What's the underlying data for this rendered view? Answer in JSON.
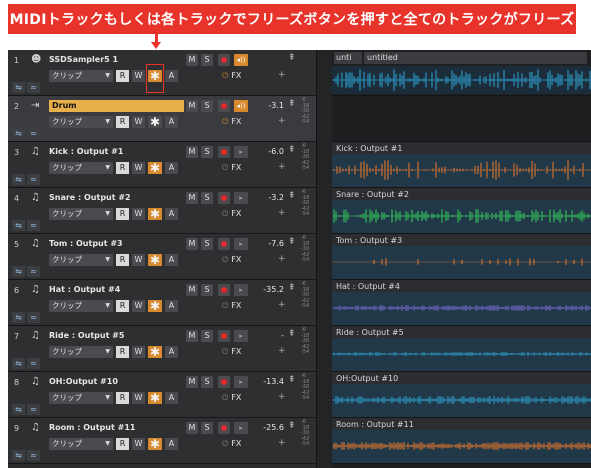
{
  "banner": {
    "text": "MIDIトラックもしくは各トラックでフリーズボタンを押すと全てのトラックがフリーズ"
  },
  "colors": {
    "accent": "#e8332a",
    "freeze_on": "#d98a2e",
    "wave_blue": "#2fa7d8",
    "wave_orange": "#f07a2a",
    "wave_green": "#38d45c",
    "wave_purple": "#7a6fd8"
  },
  "common": {
    "clip_label": "クリップ",
    "r_label": "R",
    "w_label": "W",
    "a_label": "A",
    "m_label": "M",
    "s_label": "S",
    "fx_label": "FX",
    "freeze_icon": "✱"
  },
  "tracks": [
    {
      "num": "1",
      "name": "SSDSampler5 1",
      "vol": "",
      "type": "midi"
    },
    {
      "num": "2",
      "name": "Drum",
      "vol": "-3.1",
      "type": "bus"
    },
    {
      "num": "3",
      "name": "Kick : Output #1",
      "vol": "-6.0",
      "type": "audio"
    },
    {
      "num": "4",
      "name": "Snare : Output #2",
      "vol": "-3.2",
      "type": "audio"
    },
    {
      "num": "5",
      "name": "Tom : Output #3",
      "vol": "-7.6",
      "type": "audio"
    },
    {
      "num": "6",
      "name": "Hat : Output #4",
      "vol": "-35.2",
      "type": "audio"
    },
    {
      "num": "7",
      "name": "Ride : Output #5",
      "vol": "-",
      "type": "audio"
    },
    {
      "num": "8",
      "name": "OH:Output #10",
      "vol": "-13.4",
      "type": "audio"
    },
    {
      "num": "9",
      "name": "Room : Output #11",
      "vol": "-25.6",
      "type": "audio"
    }
  ],
  "clips": [
    {
      "title": "",
      "tab1": "unti",
      "tab2": "untitled"
    },
    {
      "title": ""
    },
    {
      "title": "Kick : Output #1"
    },
    {
      "title": "Snare : Output #2"
    },
    {
      "title": "Tom : Output #3"
    },
    {
      "title": "Hat : Output #4"
    },
    {
      "title": "Ride : Output #5"
    },
    {
      "title": "OH:Output #10"
    },
    {
      "title": "Room : Output #11"
    }
  ],
  "meter_scale": [
    "-6",
    "-18",
    "-30",
    "-42",
    "-54"
  ]
}
